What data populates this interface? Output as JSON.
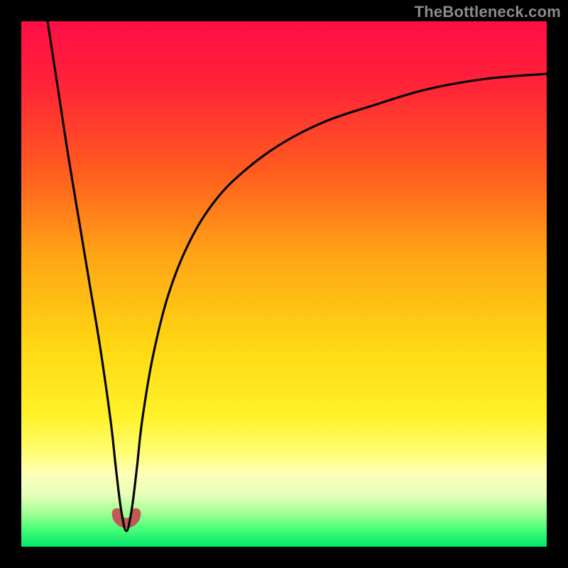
{
  "watermark": "TheBottleneck.com",
  "gradient_stops": [
    {
      "offset": 0.0,
      "color": "#ff0d47"
    },
    {
      "offset": 0.12,
      "color": "#ff2338"
    },
    {
      "offset": 0.28,
      "color": "#ff5a1f"
    },
    {
      "offset": 0.45,
      "color": "#ffa615"
    },
    {
      "offset": 0.62,
      "color": "#ffd814"
    },
    {
      "offset": 0.75,
      "color": "#fff228"
    },
    {
      "offset": 0.82,
      "color": "#fffd71"
    },
    {
      "offset": 0.86,
      "color": "#ffffb7"
    },
    {
      "offset": 0.9,
      "color": "#e7ffba"
    },
    {
      "offset": 0.935,
      "color": "#a3ff97"
    },
    {
      "offset": 0.965,
      "color": "#4dff79"
    },
    {
      "offset": 1.0,
      "color": "#00e76b"
    }
  ],
  "curve_color": "#060504",
  "curve_stroke_width": 3.2,
  "trough_marker_color": "#c15a56",
  "trough_marker_stroke": 14,
  "chart_data": {
    "type": "line",
    "title": "",
    "xlabel": "",
    "ylabel": "",
    "xlim": [
      0,
      100
    ],
    "ylim": [
      0,
      100
    ],
    "grid": false,
    "legend": false,
    "description": "Bottleneck-style V curve. x≈relative component scale (0–100), y≈bottleneck % (0 at bottom, 100 at top). Sharp minimum near x≈20, steep rise both sides; right side asymptotes toward y≈90.",
    "series": [
      {
        "name": "bottleneck-curve",
        "x": [
          5,
          7,
          9,
          11,
          13,
          15,
          17,
          18,
          19,
          20,
          21,
          22,
          23,
          25,
          28,
          32,
          37,
          43,
          50,
          58,
          67,
          77,
          88,
          100
        ],
        "y": [
          100,
          87,
          74,
          62,
          50,
          38,
          24,
          15,
          7,
          3,
          7,
          15,
          24,
          36,
          48,
          58,
          66,
          72,
          77,
          81,
          84,
          87,
          89,
          90
        ]
      }
    ],
    "trough_marker": {
      "x_range": [
        18.2,
        21.8
      ],
      "y": 4.5
    }
  }
}
